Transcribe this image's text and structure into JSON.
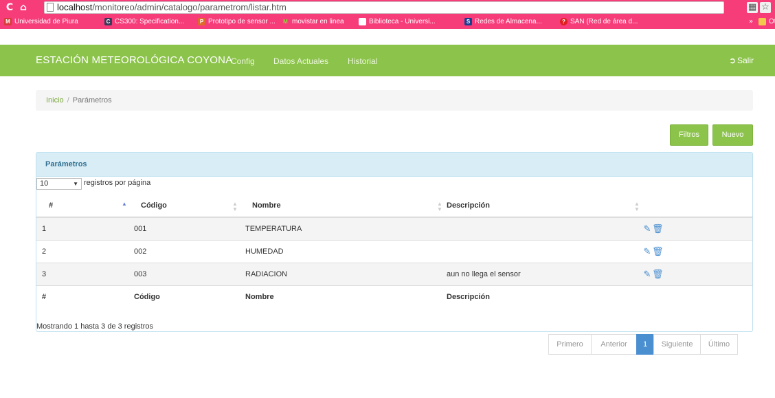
{
  "browser": {
    "url_host": "localhost",
    "url_path": "/monitoreo/admin/catalogo/parametrom/listar.htm",
    "bookmarks": [
      {
        "label": "Universidad de Piura",
        "icon": "mail-icon"
      },
      {
        "label": "CS300: Specification...",
        "icon": "cs-icon"
      },
      {
        "label": "Prototipo de sensor ...",
        "icon": "doc-icon"
      },
      {
        "label": "movistar en linea",
        "icon": "movistar-icon"
      },
      {
        "label": "Biblioteca - Universi...",
        "icon": "page-icon"
      },
      {
        "label": "Redes de Almacena...",
        "icon": "s-icon"
      },
      {
        "label": "SAN (Red de área d...",
        "icon": "question-icon"
      }
    ],
    "bookmarks_more": "»",
    "other_bookmarks": "Ot"
  },
  "navbar": {
    "brand": "ESTACIÓN METEOROLÓGICA COYONA",
    "links": [
      "Config",
      "Datos Actuales",
      "Historial"
    ],
    "logout_label": "Salir"
  },
  "breadcrumb": {
    "home": "Inicio",
    "separator": "/",
    "current": "Parámetros"
  },
  "toolbar": {
    "filters_label": "Filtros",
    "new_label": "Nuevo"
  },
  "panel": {
    "title": "Parámetros",
    "page_length": "10",
    "page_length_label": "registros por página",
    "columns": [
      "#",
      "Código",
      "Nombre",
      "Descripción"
    ],
    "rows": [
      {
        "num": "1",
        "code": "001",
        "name": "TEMPERATURA",
        "desc": ""
      },
      {
        "num": "2",
        "code": "002",
        "name": "HUMEDAD",
        "desc": ""
      },
      {
        "num": "3",
        "code": "003",
        "name": "RADIACION",
        "desc": "aun no llega el sensor"
      }
    ],
    "info": "Mostrando 1 hasta 3 de 3 registros"
  },
  "pagination": {
    "first": "Primero",
    "previous": "Anterior",
    "current": "1",
    "next": "Siguiente",
    "last": "Último"
  },
  "colors": {
    "browser_bar": "#f73c7a",
    "navbar": "#8cc34b",
    "panel_heading": "#d9edf7",
    "active_page": "#4a8fd0"
  }
}
